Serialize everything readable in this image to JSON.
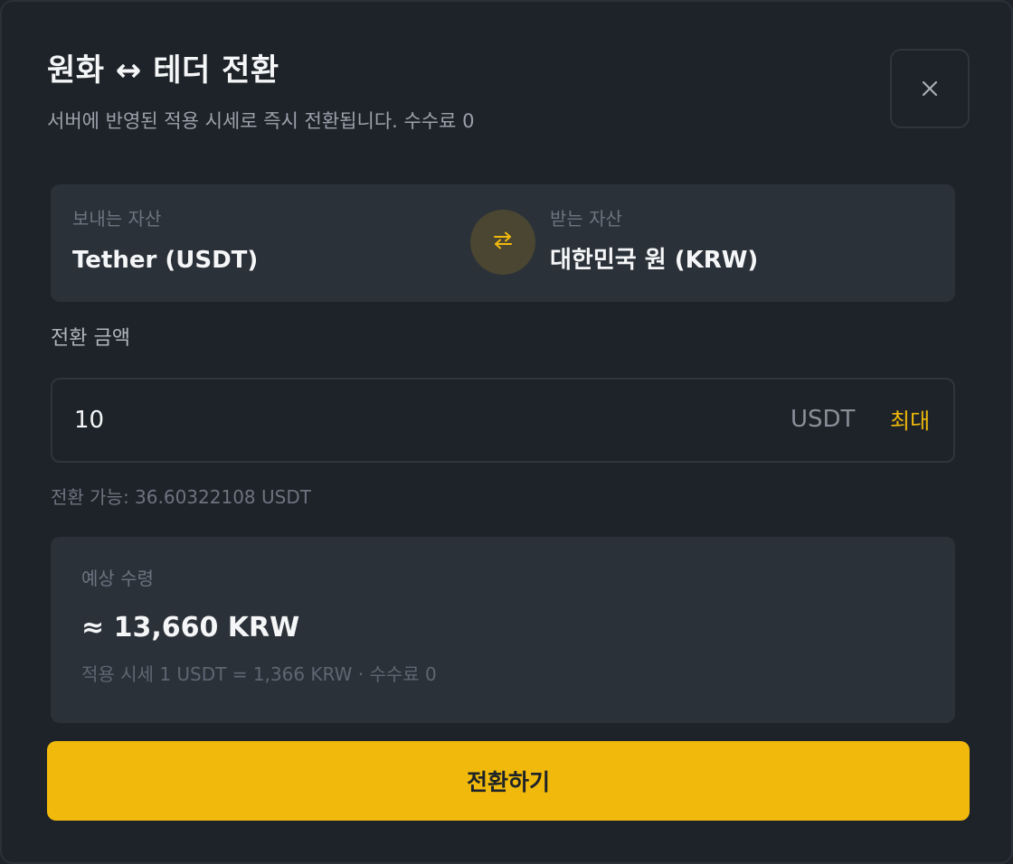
{
  "modal": {
    "title": "원화 ↔ 테더 전환",
    "subtitle": "서버에 반영된 적용 시세로 즉시 전환됩니다. 수수료 0",
    "close_icon": "close-icon"
  },
  "assets": {
    "from_label": "보내는 자산",
    "from_value": "Tether (USDT)",
    "to_label": "받는 자산",
    "to_value": "대한민국 원 (KRW)",
    "swap_icon": "swap-arrows-icon",
    "swap_color": "#f0b90b"
  },
  "amount": {
    "label": "전환 금액",
    "value": "10",
    "unit": "USDT",
    "max_label": "최대"
  },
  "available": {
    "text": "전환 가능: 36.60322108 USDT"
  },
  "estimate": {
    "label": "예상 수령",
    "value": "≈ 13,660 KRW",
    "rate_text": "적용 시세 1 USDT = 1,366 KRW · 수수료 0"
  },
  "submit": {
    "label": "전환하기"
  },
  "colors": {
    "background": "#1e2329",
    "panel": "#2b3139",
    "accent": "#f0b90b"
  }
}
